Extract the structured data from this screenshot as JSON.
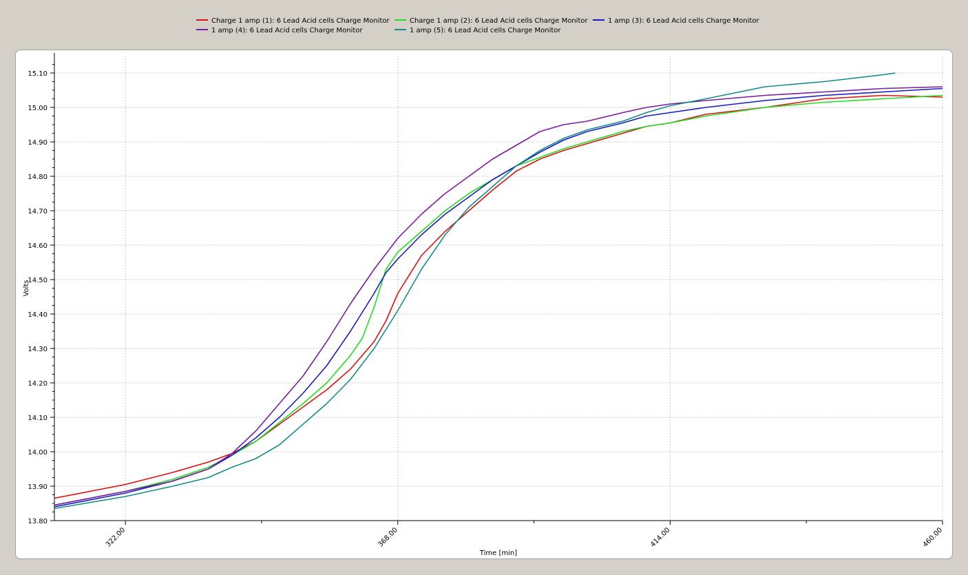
{
  "chart_data": {
    "type": "line",
    "title": "",
    "xlabel": "Time [min]",
    "ylabel": "Volts",
    "xlim": [
      310,
      460
    ],
    "ylim": [
      13.8,
      15.15
    ],
    "xticks": [
      "322.00",
      "368.00",
      "414.00",
      "460.00"
    ],
    "yticks": [
      "13.80",
      "13.90",
      "14.00",
      "14.10",
      "14.20",
      "14.30",
      "14.40",
      "14.50",
      "14.60",
      "14.70",
      "14.80",
      "14.90",
      "15.00",
      "15.10"
    ],
    "grid": true,
    "legend_position": "top",
    "series": [
      {
        "name": "Charge 1 amp (1): 6 Lead Acid cells Charge Monitor",
        "color": "#e01010",
        "x": [
          310,
          322,
          330,
          336,
          340,
          344,
          348,
          352,
          356,
          360,
          364,
          366,
          368,
          372,
          376,
          380,
          384,
          388,
          392,
          396,
          400,
          406,
          410,
          414,
          420,
          430,
          440,
          450,
          460
        ],
        "y": [
          13.865,
          13.905,
          13.94,
          13.97,
          13.995,
          14.03,
          14.08,
          14.13,
          14.18,
          14.24,
          14.32,
          14.38,
          14.46,
          14.57,
          14.64,
          14.7,
          14.76,
          14.815,
          14.85,
          14.875,
          14.895,
          14.925,
          14.945,
          14.955,
          14.98,
          15.0,
          15.025,
          15.035,
          15.03
        ]
      },
      {
        "name": "Charge 1 amp (2): 6 Lead Acid cells Charge Monitor",
        "color": "#22dd22",
        "x": [
          310,
          322,
          330,
          336,
          340,
          344,
          348,
          352,
          356,
          360,
          362,
          364,
          366,
          368,
          372,
          376,
          380,
          384,
          388,
          392,
          396,
          400,
          406,
          410,
          414,
          420,
          430,
          440,
          450,
          460
        ],
        "y": [
          13.845,
          13.885,
          13.92,
          13.955,
          13.99,
          14.03,
          14.085,
          14.14,
          14.2,
          14.28,
          14.33,
          14.42,
          14.53,
          14.58,
          14.64,
          14.7,
          14.75,
          14.79,
          14.83,
          14.855,
          14.88,
          14.9,
          14.93,
          14.945,
          14.955,
          14.975,
          15.0,
          15.015,
          15.025,
          15.035
        ]
      },
      {
        "name": "1 amp (3): 6 Lead Acid cells Charge Monitor",
        "color": "#1818c8",
        "x": [
          310,
          322,
          330,
          336,
          340,
          344,
          348,
          352,
          356,
          360,
          364,
          366,
          368,
          372,
          376,
          380,
          384,
          388,
          392,
          396,
          400,
          406,
          410,
          414,
          420,
          430,
          440,
          450,
          460
        ],
        "y": [
          13.84,
          13.88,
          13.915,
          13.95,
          13.99,
          14.04,
          14.1,
          14.17,
          14.25,
          14.35,
          14.46,
          14.52,
          14.56,
          14.63,
          14.69,
          14.74,
          14.79,
          14.83,
          14.87,
          14.905,
          14.93,
          14.955,
          14.975,
          14.985,
          15.0,
          15.02,
          15.035,
          15.045,
          15.055
        ]
      },
      {
        "name": "1 amp (4): 6 Lead Acid cells Charge Monitor",
        "color": "#7a1aa0",
        "x": [
          310,
          322,
          330,
          336,
          340,
          344,
          348,
          352,
          356,
          360,
          364,
          368,
          372,
          376,
          380,
          384,
          388,
          392,
          396,
          400,
          406,
          410,
          414,
          420,
          430,
          440,
          450,
          460
        ],
        "y": [
          13.845,
          13.885,
          13.915,
          13.95,
          13.995,
          14.06,
          14.14,
          14.22,
          14.32,
          14.43,
          14.53,
          14.62,
          14.69,
          14.75,
          14.8,
          14.85,
          14.89,
          14.93,
          14.95,
          14.96,
          14.985,
          15.0,
          15.01,
          15.02,
          15.035,
          15.045,
          15.055,
          15.06
        ]
      },
      {
        "name": "1 amp (5): 6 Lead Acid cells Charge Monitor",
        "color": "#178a8a",
        "x": [
          310,
          322,
          330,
          336,
          340,
          344,
          348,
          352,
          356,
          360,
          364,
          368,
          372,
          376,
          380,
          384,
          388,
          392,
          396,
          400,
          406,
          410,
          414,
          420,
          430,
          440,
          450,
          452
        ],
        "y": [
          13.835,
          13.87,
          13.9,
          13.925,
          13.955,
          13.98,
          14.02,
          14.08,
          14.14,
          14.21,
          14.3,
          14.41,
          14.53,
          14.63,
          14.71,
          14.77,
          14.83,
          14.875,
          14.91,
          14.935,
          14.96,
          14.985,
          15.005,
          15.025,
          15.06,
          15.075,
          15.095,
          15.1
        ]
      }
    ]
  }
}
